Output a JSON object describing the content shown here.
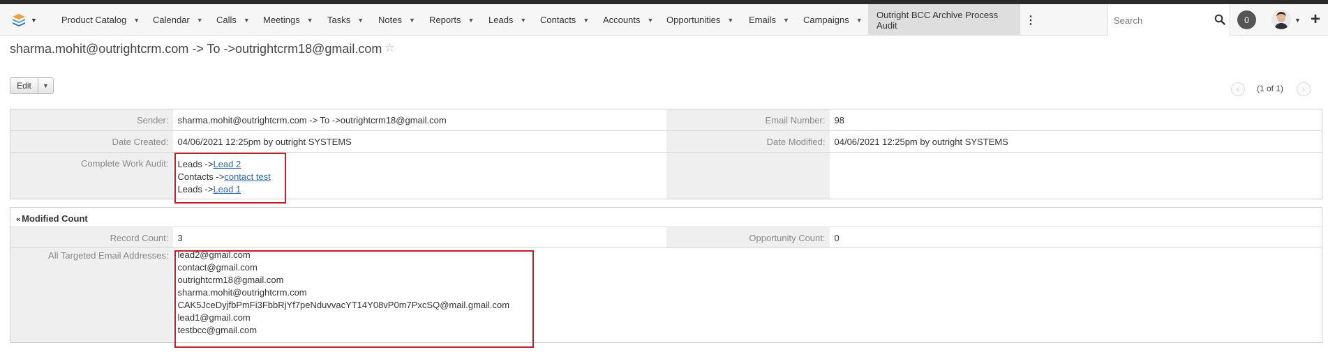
{
  "navbar": {
    "items": [
      {
        "label": "Product Catalog"
      },
      {
        "label": "Calendar"
      },
      {
        "label": "Calls"
      },
      {
        "label": "Meetings"
      },
      {
        "label": "Tasks"
      },
      {
        "label": "Notes"
      },
      {
        "label": "Reports"
      },
      {
        "label": "Leads"
      },
      {
        "label": "Contacts"
      },
      {
        "label": "Accounts"
      },
      {
        "label": "Opportunities"
      },
      {
        "label": "Emails"
      },
      {
        "label": "Campaigns"
      }
    ],
    "active_module": "Outright BCC Archive Process Audit",
    "search_placeholder": "Search",
    "notification_count": "0",
    "colors": {
      "background": "#f6f6f6",
      "active_tab": "#dedede"
    }
  },
  "record": {
    "title": "sharma.mohit@outrightcrm.com -> To ->outrightcrm18@gmail.com",
    "edit_label": "Edit",
    "pagination": "(1 of 1)"
  },
  "overview": {
    "sender_label": "Sender:",
    "sender_value": "sharma.mohit@outrightcrm.com -> To ->outrightcrm18@gmail.com",
    "email_number_label": "Email Number:",
    "email_number_value": "98",
    "date_created_label": "Date Created:",
    "date_created_value": "04/06/2021 12:25pm by outright SYSTEMS",
    "date_modified_label": "Date Modified:",
    "date_modified_value": "04/06/2021 12:25pm by outright SYSTEMS",
    "audit_label": "Complete Work Audit:",
    "audit_entries": [
      {
        "prefix": "Leads ->",
        "link": "Lead 2"
      },
      {
        "prefix": "Contacts ->",
        "link": "contact test"
      },
      {
        "prefix": "Leads ->",
        "link": "Lead 1"
      }
    ]
  },
  "modified_count": {
    "panel_title": "Modified Count",
    "record_count_label": "Record Count:",
    "record_count_value": "3",
    "opportunity_count_label": "Opportunity Count:",
    "opportunity_count_value": "0",
    "addresses_label": "All Targeted Email Addresses:",
    "addresses": [
      "lead2@gmail.com",
      "contact@gmail.com",
      "outrightcrm18@gmail.com",
      "sharma.mohit@outrightcrm.com",
      "CAK5JceDyjfbPmFi3FbbRjYf7peNduvvacYT14Y08vP0m7PxcSQ@mail.gmail.com",
      "lead1@gmail.com",
      "testbcc@gmail.com"
    ]
  },
  "highlight_color": "#c0202a"
}
